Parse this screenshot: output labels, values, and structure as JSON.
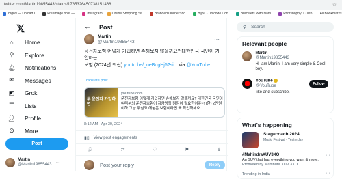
{
  "browser": {
    "url": "twitter.com/Martin19855443/status/1785326450738151466",
    "bookmarks": [
      "img89 — Upload I...",
      "Freemage.host —...",
      "Instagram",
      "Online Shopping Sit...",
      "Branded Online Sho...",
      "Bijou - Unicode Con...",
      "Bracelets With Nam...",
      "Printshoppy: Custo..."
    ],
    "all_bookmarks": "All Bookmarks"
  },
  "nav": {
    "items": [
      {
        "label": "Home",
        "icon": "home-icon"
      },
      {
        "label": "Explore",
        "icon": "search-icon"
      },
      {
        "label": "Notifications",
        "icon": "bell-icon"
      },
      {
        "label": "Messages",
        "icon": "mail-icon"
      },
      {
        "label": "Grok",
        "icon": "grok-icon"
      },
      {
        "label": "Lists",
        "icon": "list-icon"
      },
      {
        "label": "Profile",
        "icon": "person-icon"
      },
      {
        "label": "More",
        "icon": "more-icon"
      }
    ],
    "post_button": "Post",
    "account": {
      "name": "Martin",
      "handle": "@Martin19855443"
    }
  },
  "post": {
    "header": "Post",
    "author_name": "Martin",
    "author_handle": "@Martin19855443",
    "text_line1": "공전자보험 어떻게 가입하면 손해보지 않을까요? 대한민국 국민이 가입하는",
    "text_line2_prefix": "보험 (2024년 최신) ",
    "link": "youtu.be/_ueBugHj5?si...",
    "via": " via ",
    "via_link": "@YouTube",
    "translate": "Translate post",
    "card_domain": "youtube.com",
    "card_title": "운전자보험 어떻게 가입하면 손해보지 않을까요? 대한민국 국민이 여러분의 운전자보험이 지금당장 점검이 필요한이유~! (한) 2만원 이하 그냥 무심코 해놓은 보험이라면 꼭 확인하세요",
    "card_thumb_text": "두 운전자 가입하면",
    "timestamp": "8:12 AM · Apr 30, 2024",
    "engagements": "View post engagements",
    "reply_placeholder": "Post your reply",
    "reply_button": "Reply"
  },
  "sidebar": {
    "search_placeholder": "Search",
    "relevant_title": "Relevant people",
    "people": [
      {
        "name": "Martin",
        "handle": "@Martin19855443",
        "bio": "Hi iam Martin. I am very simple & Cool boy."
      },
      {
        "name": "YouTube",
        "handle": "@YouTube",
        "bio": "like and subscribe.",
        "follow": "Follow"
      }
    ],
    "happening_title": "What's happening",
    "event": {
      "name": "Stagecoach 2024",
      "meta": "Music Festival · Yesterday"
    },
    "trends": [
      {
        "name": "#MahindraXUV3XO",
        "desc": "An SUV that has everything you want & more.",
        "meta": "Promoted by Mahindra XUV 3XO"
      },
      {
        "name": "Trending in India",
        "desc": "",
        "meta": ""
      }
    ]
  }
}
